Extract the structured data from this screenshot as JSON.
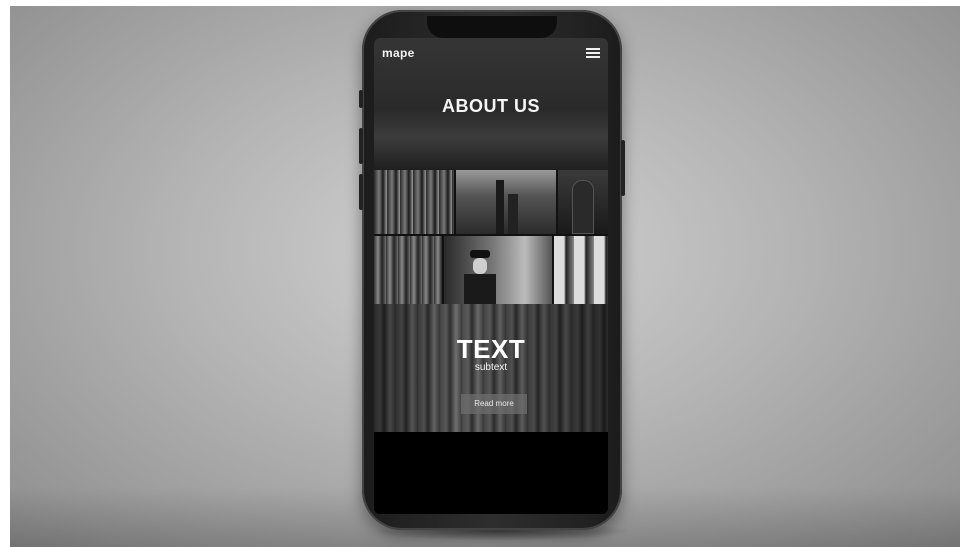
{
  "app": {
    "brand": "mape"
  },
  "page": {
    "title": "ABOUT US"
  },
  "hero": {
    "title": "TEXT",
    "subtitle": "subtext",
    "button_label": "Read more"
  },
  "icons": {
    "menu": "hamburger-menu-icon"
  },
  "colors": {
    "background": "#b5b5b5",
    "phone_body": "#2a2a2a",
    "screen": "#000000",
    "button": "#6e6e6e",
    "text": "#ffffff"
  }
}
